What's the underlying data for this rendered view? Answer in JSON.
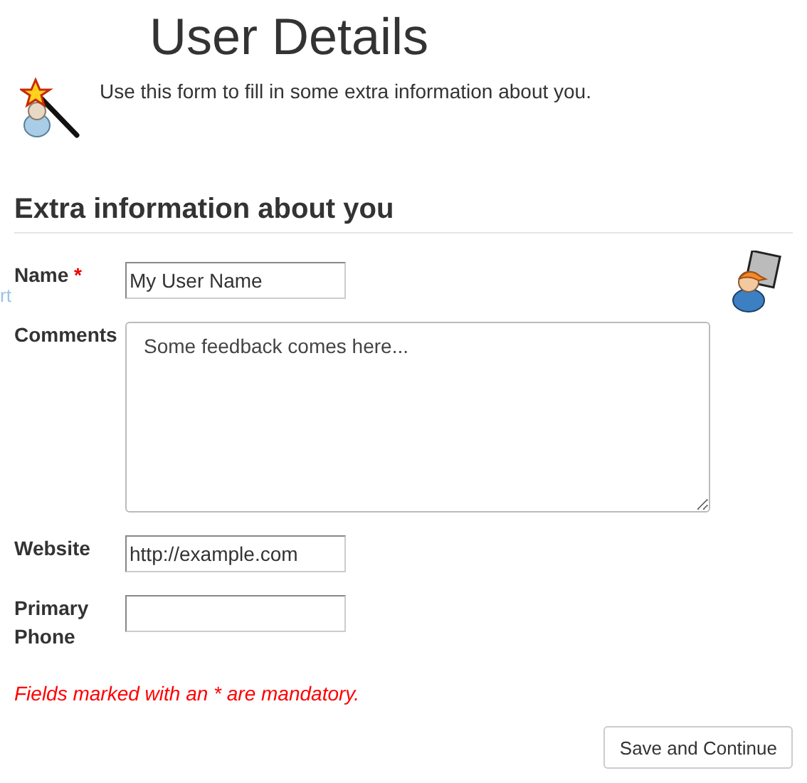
{
  "page_title": "User Details",
  "intro": "Use this form to fill in some extra information about you.",
  "edge_text": "rt",
  "section_title": "Extra information about you",
  "fields": [
    {
      "kind": "text",
      "label": "Name",
      "required_mark": "*",
      "value": "My User Name"
    },
    {
      "kind": "textarea",
      "label": "Comments",
      "value": "Some feedback comes here..."
    },
    {
      "kind": "text",
      "label": "Website",
      "value": "http://example.com"
    },
    {
      "kind": "text",
      "label": "Primary Phone"
    }
  ],
  "note": "Fields marked with an * are mandatory.",
  "buttons": [
    "Save and Continue"
  ]
}
